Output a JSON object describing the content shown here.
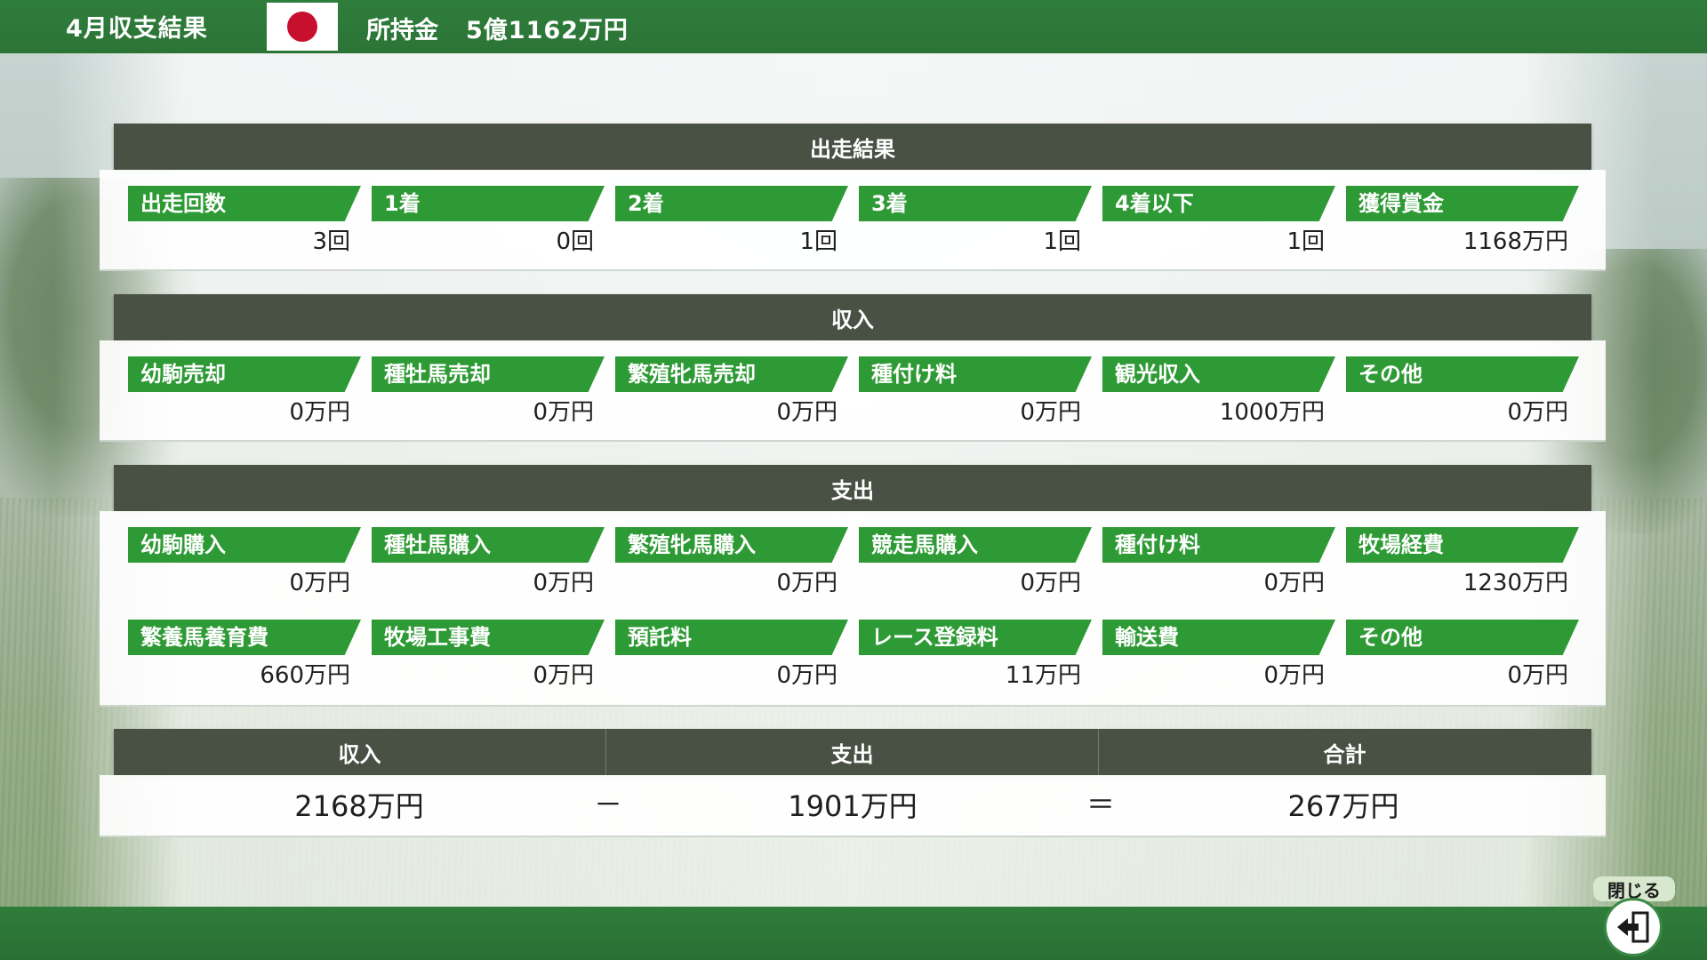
{
  "header": {
    "title": "4月収支結果",
    "money_label": "所持金",
    "money_value": "5億1162万円",
    "flag_icon": "japan-flag-icon"
  },
  "race_results": {
    "title": "出走結果",
    "items": [
      {
        "label": "出走回数",
        "value": "3回"
      },
      {
        "label": "1着",
        "value": "0回"
      },
      {
        "label": "2着",
        "value": "1回"
      },
      {
        "label": "3着",
        "value": "1回"
      },
      {
        "label": "4着以下",
        "value": "1回"
      },
      {
        "label": "獲得賞金",
        "value": "1168万円"
      }
    ]
  },
  "income": {
    "title": "収入",
    "items": [
      {
        "label": "幼駒売却",
        "value": "0万円"
      },
      {
        "label": "種牡馬売却",
        "value": "0万円"
      },
      {
        "label": "繁殖牝馬売却",
        "value": "0万円"
      },
      {
        "label": "種付け料",
        "value": "0万円"
      },
      {
        "label": "観光収入",
        "value": "1000万円"
      },
      {
        "label": "その他",
        "value": "0万円"
      }
    ]
  },
  "expense": {
    "title": "支出",
    "items": [
      {
        "label": "幼駒購入",
        "value": "0万円"
      },
      {
        "label": "種牡馬購入",
        "value": "0万円"
      },
      {
        "label": "繁殖牝馬購入",
        "value": "0万円"
      },
      {
        "label": "競走馬購入",
        "value": "0万円"
      },
      {
        "label": "種付け料",
        "value": "0万円"
      },
      {
        "label": "牧場経費",
        "value": "1230万円"
      },
      {
        "label": "繁養馬養育費",
        "value": "660万円"
      },
      {
        "label": "牧場工事費",
        "value": "0万円"
      },
      {
        "label": "預託料",
        "value": "0万円"
      },
      {
        "label": "レース登録料",
        "value": "11万円"
      },
      {
        "label": "輸送費",
        "value": "0万円"
      },
      {
        "label": "その他",
        "value": "0万円"
      }
    ]
  },
  "summary": {
    "income_label": "収入",
    "expense_label": "支出",
    "total_label": "合計",
    "income_value": "2168万円",
    "expense_value": "1901万円",
    "total_value": "267万円",
    "minus_sign": "－",
    "equals_sign": "＝"
  },
  "footer": {
    "close_label": "閉じる",
    "close_icon": "exit-door-icon"
  },
  "colors": {
    "bar_green": "#2f7d3b",
    "tag_green": "#2e9a35",
    "header_dark": "#495044",
    "flag_red": "#c8102e"
  }
}
